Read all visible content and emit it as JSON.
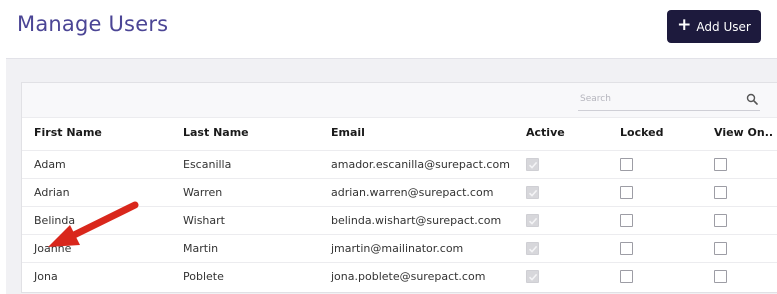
{
  "header": {
    "title": "Manage Users",
    "add_button_label": "Add User"
  },
  "search": {
    "placeholder": "Search",
    "value": ""
  },
  "table": {
    "columns": [
      "First Name",
      "Last Name",
      "Email",
      "Active",
      "Locked",
      "View On.."
    ],
    "rows": [
      {
        "first": "Adam",
        "last": "Escanilla",
        "email": "amador.escanilla@surepact.com",
        "active": true,
        "locked": false,
        "view_only": false
      },
      {
        "first": "Adrian",
        "last": "Warren",
        "email": "adrian.warren@surepact.com",
        "active": true,
        "locked": false,
        "view_only": false
      },
      {
        "first": "Belinda",
        "last": "Wishart",
        "email": "belinda.wishart@surepact.com",
        "active": true,
        "locked": false,
        "view_only": false
      },
      {
        "first": "Joanne",
        "last": "Martin",
        "email": "jmartin@mailinator.com",
        "active": true,
        "locked": false,
        "view_only": false
      },
      {
        "first": "Jona",
        "last": "Poblete",
        "email": "jona.poblete@surepact.com",
        "active": true,
        "locked": false,
        "view_only": false
      }
    ]
  },
  "colors": {
    "title": "#4b4595",
    "button_bg": "#1d1a3d",
    "annotation_arrow": "#d9271c"
  },
  "icons": {
    "add": "plus-icon",
    "search": "search-icon",
    "annotation": "red-arrow-annotation"
  }
}
